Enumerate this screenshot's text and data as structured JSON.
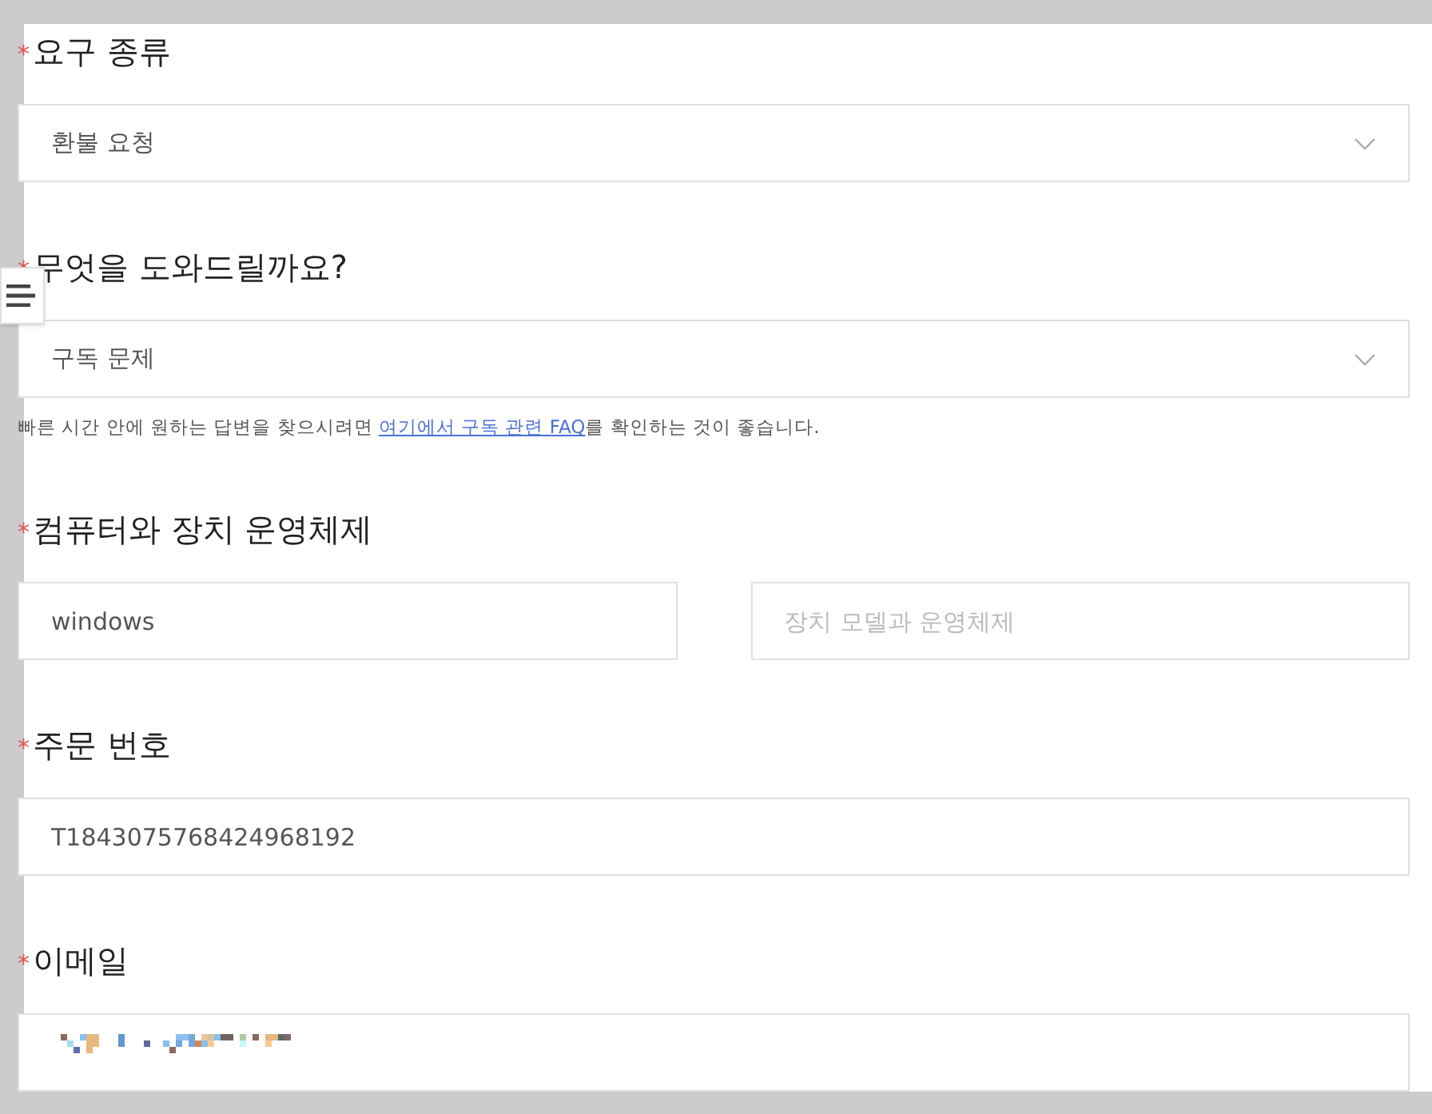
{
  "menu_button": {
    "expanded": false
  },
  "fields": [
    {
      "kind": "select",
      "label": "요구 종류",
      "required": "*",
      "value": "환불 요청"
    },
    {
      "kind": "select",
      "label": "무엇을 도와드릴까요?",
      "required": "*",
      "value": "구독 문제",
      "help": {
        "before": "빠른 시간 안에 원하는 답변을 찾으시려면 ",
        "link": "여기에서 구독 관련 FAQ",
        "after": "를 확인하는 것이 좋습니다."
      }
    },
    {
      "kind": "pair",
      "label": "컴퓨터와 장치 운영체제",
      "required": "*",
      "inputs": [
        {
          "value": "windows"
        },
        {
          "placeholder": "장치 모델과 운영체제"
        }
      ]
    },
    {
      "kind": "text",
      "label": "주문 번호",
      "required": "*",
      "value": "T1843075768424968192"
    },
    {
      "kind": "redacted",
      "label": "이메일",
      "required": "*"
    }
  ]
}
